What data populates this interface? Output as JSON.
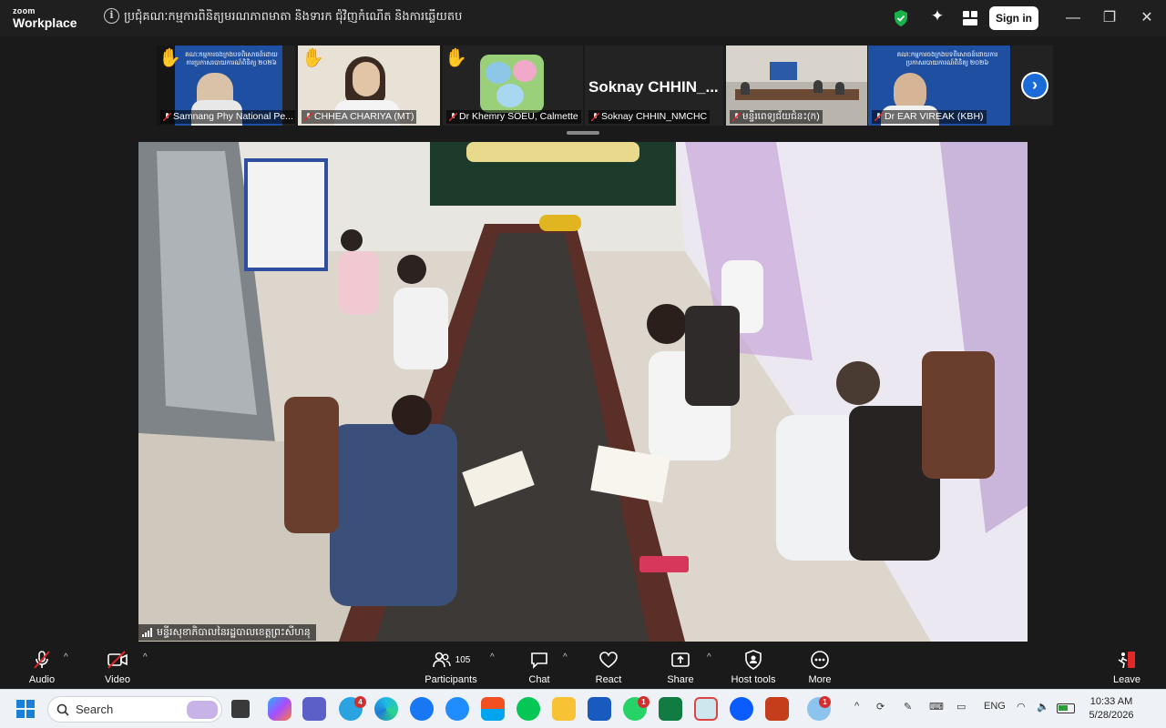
{
  "app": {
    "logo_line1": "zoom",
    "logo_line2": "Workplace",
    "meeting_title": "ប្រជុំគណៈកម្មការពិនិត្យមរណភាពមាតា និងទារក ជុំវិញកំណើត និងការឆ្លើយតប",
    "signin_label": "Sign in"
  },
  "participants_strip": [
    {
      "name": "Samnang Phy National Pe...",
      "hand_raised": true,
      "muted": true
    },
    {
      "name": "CHHEA CHARIYA (MT)",
      "hand_raised": true,
      "muted": true
    },
    {
      "name": "Dr Khemry SOEU, Calmette",
      "hand_raised": true,
      "muted": true
    },
    {
      "name": "Soknay CHHIN_NMCHC",
      "display_text": "Soknay  CHHIN_...",
      "hand_raised": false,
      "muted": true
    },
    {
      "name": "មន្ទីរពេទ្យជ័យជំនះ(ក)",
      "hand_raised": false,
      "muted": true
    },
    {
      "name": "Dr EAR VIREAK (KBH)",
      "hand_raised": false,
      "muted": true
    }
  ],
  "banner_text": "គណៈកម្មការចងក្រងបទពិសោធន៍ដោយការប្រកាសរបាយការណ៍ពិនិត្យ ២០២៦",
  "main_video": {
    "label": "មន្ទីរសុខាភិបាលនៃរដ្ឋបាលខេត្តព្រះសីហនុ"
  },
  "toolbar": {
    "audio": "Audio",
    "video": "Video",
    "participants": "Participants",
    "participants_count": "105",
    "chat": "Chat",
    "react": "React",
    "share": "Share",
    "host_tools": "Host tools",
    "more": "More",
    "leave": "Leave"
  },
  "taskbar": {
    "search_label": "Search",
    "telegram_badge": "4",
    "whatsapp_badge": "1",
    "weather_badge": "1",
    "lang": "ENG",
    "time": "10:33 AM",
    "date": "5/28/2026"
  },
  "colors": {
    "accent_blue": "#1a6bd8",
    "leave_red": "#e02828",
    "shield_green": "#19b24b"
  }
}
